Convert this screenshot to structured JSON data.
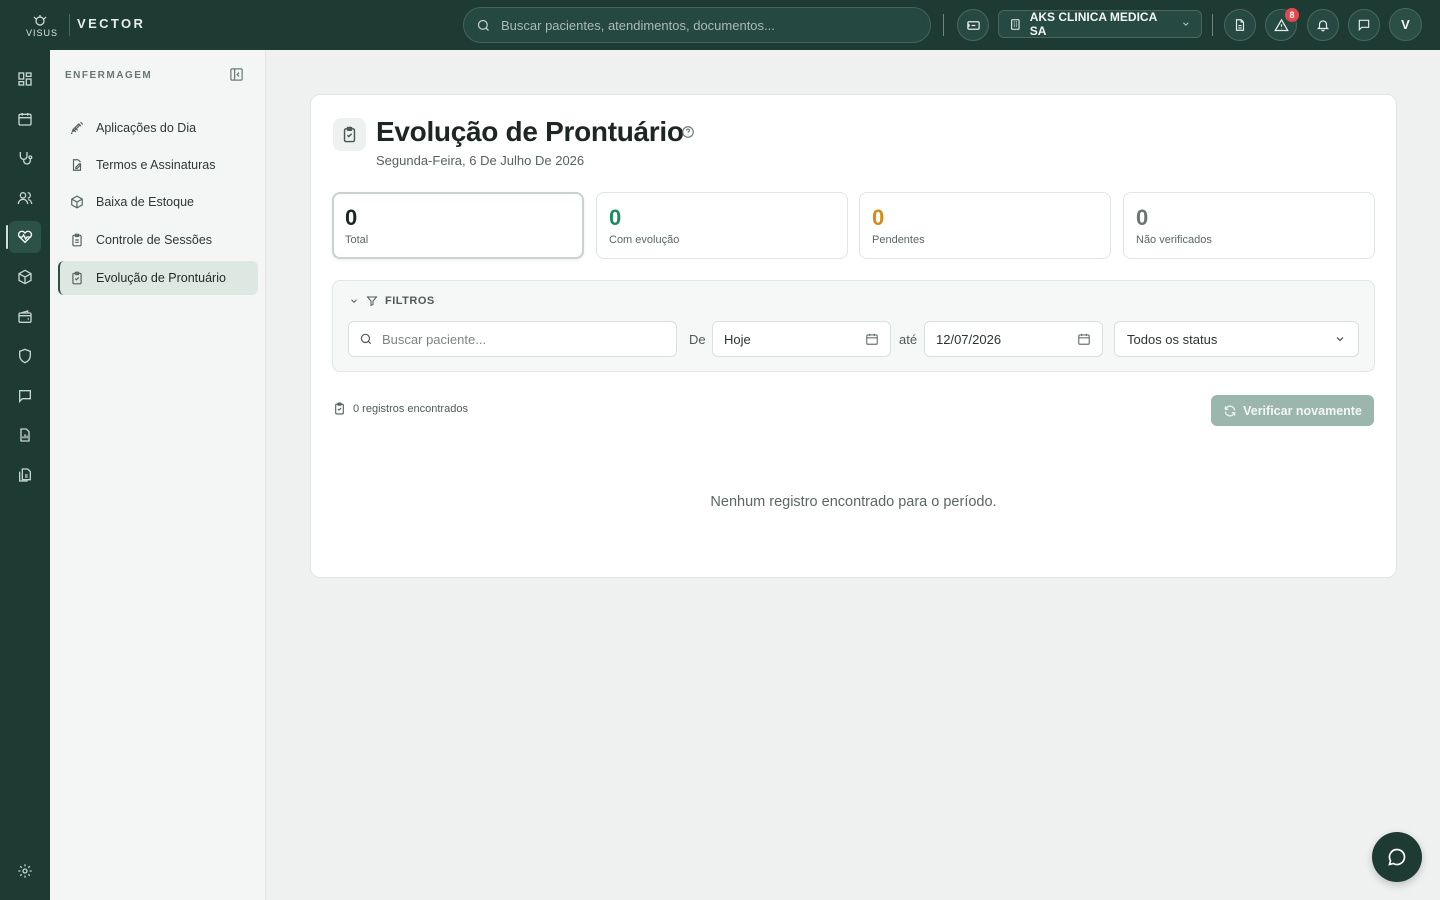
{
  "topbar": {
    "logo_text": "VISUS",
    "brand": "VECTOR",
    "search_placeholder": "Buscar pacientes, atendimentos, documentos...",
    "organization": "AKS CLINICA MEDICA SA",
    "alerts_badge": "8",
    "avatar_initial": "V"
  },
  "sidebar": {
    "section_title": "ENFERMAGEM",
    "items": [
      {
        "label": "Aplicações do Dia",
        "icon": "syringe-icon"
      },
      {
        "label": "Termos e Assinaturas",
        "icon": "file-signature-icon"
      },
      {
        "label": "Baixa de Estoque",
        "icon": "package-icon"
      },
      {
        "label": "Controle de Sessões",
        "icon": "clipboard-icon"
      },
      {
        "label": "Evolução de Prontuário",
        "icon": "clipboard-check-icon",
        "active": true
      }
    ]
  },
  "page": {
    "title": "Evolução de Prontuário",
    "date": "Segunda-Feira, 6 De Julho De 2026"
  },
  "stats": [
    {
      "value": "0",
      "label": "Total",
      "color": "#1d2623"
    },
    {
      "value": "0",
      "label": "Com evolução",
      "color": "#1f8a62"
    },
    {
      "value": "0",
      "label": "Pendentes",
      "color": "#d88a16"
    },
    {
      "value": "0",
      "label": "Não verificados",
      "color": "#6b7571"
    }
  ],
  "filters": {
    "title": "FILTROS",
    "patient_placeholder": "Buscar paciente...",
    "from_label": "De",
    "from_value": "Hoje",
    "to_label": "até",
    "to_value": "12/07/2026",
    "status_value": "Todos os status"
  },
  "results": {
    "count_text": "0 registros encontrados",
    "reverify_label": "Verificar novamente",
    "empty_message": "Nenhum registro encontrado para o período."
  },
  "colors": {
    "brand_dark": "#1e3b33",
    "accent_green": "#1f8a62",
    "accent_orange": "#d88a16",
    "badge_red": "#e5484d"
  }
}
